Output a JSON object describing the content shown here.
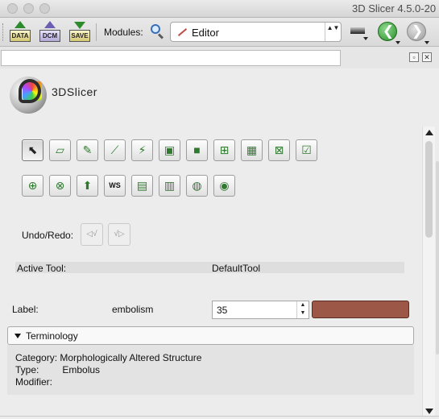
{
  "window": {
    "title": "3D Slicer 4.5.0-20"
  },
  "toolbar": {
    "data_label": "DATA",
    "dcm_label": "DCM",
    "save_label": "SAVE",
    "modules_label": "Modules:",
    "module_selected": "Editor",
    "stepper_glyph": "▲▼",
    "back_glyph": "❮",
    "forward_glyph": "❯"
  },
  "dock": {
    "float_glyph": "▫",
    "close_glyph": "✕"
  },
  "panel": {
    "brand": "3DSlicer",
    "tools_row1": [
      {
        "name": "default-tool-icon",
        "glyph": "⬉"
      },
      {
        "name": "erase-label-icon",
        "glyph": "▱"
      },
      {
        "name": "paint-effect-icon",
        "glyph": "✎"
      },
      {
        "name": "draw-effect-icon",
        "glyph": "⟋"
      },
      {
        "name": "level-tracing-icon",
        "glyph": "⚡"
      },
      {
        "name": "image-effect-icon",
        "glyph": "▣"
      },
      {
        "name": "rectangle-effect-icon",
        "glyph": "■"
      },
      {
        "name": "grow-cut-icon",
        "glyph": "⊞"
      },
      {
        "name": "threshold-effect-icon",
        "glyph": "▦"
      },
      {
        "name": "change-label-icon",
        "glyph": "⊠"
      },
      {
        "name": "identify-islands-icon",
        "glyph": "☑"
      }
    ],
    "tools_row2": [
      {
        "name": "dilate-effect-icon",
        "glyph": "⊕"
      },
      {
        "name": "erode-effect-icon",
        "glyph": "⊗"
      },
      {
        "name": "model-maker-icon",
        "glyph": "⬆"
      },
      {
        "name": "watershed-icon",
        "glyph": "WS"
      },
      {
        "name": "save-island-icon",
        "glyph": "▤"
      },
      {
        "name": "remove-islands-icon",
        "glyph": "▥"
      },
      {
        "name": "fast-marching-icon",
        "glyph": "◍"
      },
      {
        "name": "wand-effect-icon",
        "glyph": "◉"
      }
    ],
    "undo_redo_label": "Undo/Redo:",
    "undo_glyph": "◁√",
    "redo_glyph": "√▷",
    "active_tool_label": "Active Tool:",
    "active_tool_value": "DefaultTool",
    "label_caption": "Label:",
    "label_name": "embolism",
    "label_value": "35",
    "label_color": "#9d5747",
    "spin_glyph": "▲\n▼"
  },
  "terminology": {
    "header": "Terminology",
    "category_key": "Category:",
    "category_value": "Morphologically Altered Structure",
    "type_key": "Type:",
    "type_value": "Embolus",
    "modifier_key": "Modifier:",
    "modifier_value": ""
  }
}
